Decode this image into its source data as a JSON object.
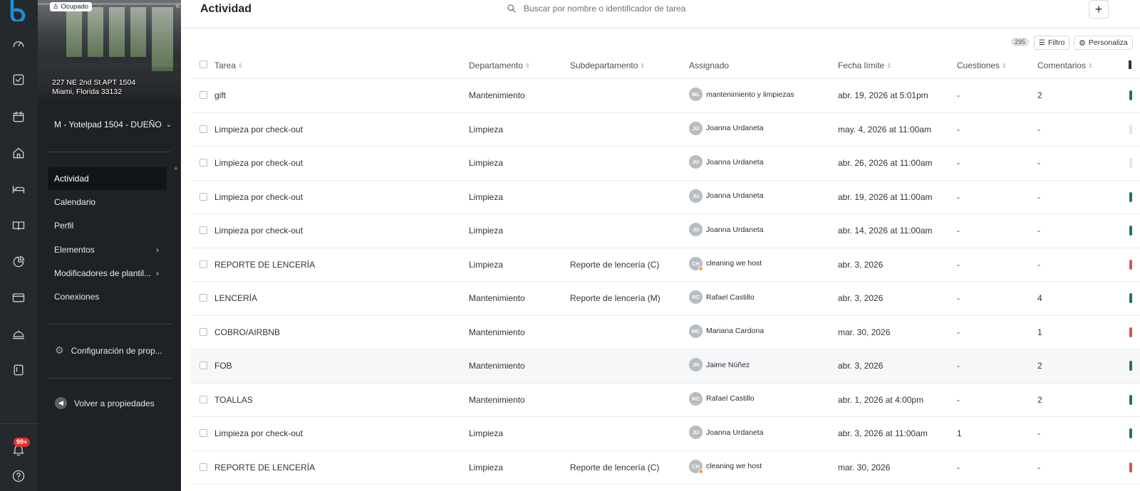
{
  "sidebar": {
    "status_badge": "Ocupado",
    "address_line1": "227 NE 2nd St APT 1504",
    "address_line2": "Miami, Florida 33132",
    "owner_label": "M - Yotelpad 1504 - DUEÑO",
    "nav": [
      {
        "label": "Actividad",
        "active": true
      },
      {
        "label": "Calendario"
      },
      {
        "label": "Perfil"
      },
      {
        "label": "Elementos",
        "submenu": true
      },
      {
        "label": "Modificadores de plantil...",
        "submenu": true
      },
      {
        "label": "Conexiones"
      }
    ],
    "config_label": "Configuración de prop...",
    "back_label": "Volver a propiedades"
  },
  "rail": {
    "icons": [
      "dashboard-icon",
      "inbox-icon",
      "calendar-icon",
      "home-icon",
      "bed-icon",
      "book-icon",
      "chart-icon",
      "card-icon",
      "service-icon",
      "document-icon"
    ],
    "notification_badge": "99+"
  },
  "header": {
    "title": "Actividad",
    "search_placeholder": "Buscar por nombre o identificador de tarea"
  },
  "toolbar": {
    "count": "295",
    "filter_label": "Filtro",
    "customize_label": "Personaliza"
  },
  "table": {
    "columns": [
      "Tarea",
      "Departamento",
      "Subdepartamento",
      "Assignado",
      "Fecha límite",
      "Cuestiones",
      "Comentarios"
    ],
    "rows": [
      {
        "task": "gift",
        "dept": "Mantenimiento",
        "subdept": "",
        "initials": "ML",
        "assignee": "mantenimiento y limpiezas",
        "due": "abr. 19, 2026 at 5:01pm",
        "issues": "-",
        "comments": "2",
        "edge": "#1e7a46"
      },
      {
        "task": "Limpieza por check-out",
        "dept": "Limpieza",
        "subdept": "",
        "initials": "JU",
        "assignee": "Joanna Urdaneta",
        "due": "may. 4, 2026 at 11:00am",
        "issues": "-",
        "comments": "-",
        "edge": "#e3e6e9"
      },
      {
        "task": "Limpieza por check-out",
        "dept": "Limpieza",
        "subdept": "",
        "initials": "JU",
        "assignee": "Joanna Urdaneta",
        "due": "abr. 26, 2026 at 11:00am",
        "issues": "-",
        "comments": "-",
        "edge": "#e3e6e9"
      },
      {
        "task": "Limpieza por check-out",
        "dept": "Limpieza",
        "subdept": "",
        "initials": "JU",
        "assignee": "Joanna Urdaneta",
        "due": "abr. 19, 2026 at 11:00am",
        "issues": "-",
        "comments": "-",
        "edge": "#1e7a46"
      },
      {
        "task": "Limpieza por check-out",
        "dept": "Limpieza",
        "subdept": "",
        "initials": "JU",
        "assignee": "Joanna Urdaneta",
        "due": "abr. 14, 2026 at 11:00am",
        "issues": "-",
        "comments": "-",
        "edge": "#1e7a46"
      },
      {
        "task": "REPORTE DE LENCERÍA",
        "dept": "Limpieza",
        "subdept": "Reporte de lencería (C)",
        "initials": "CH",
        "assignee": "cleaning we host",
        "due": "abr. 3, 2026",
        "issues": "-",
        "comments": "-",
        "edge": "#d9534f",
        "star": true
      },
      {
        "task": "LENCERÍA",
        "dept": "Mantenimiento",
        "subdept": "Reporte de lencería (M)",
        "initials": "RC",
        "assignee": "Rafael Castillo",
        "due": "abr. 3, 2026",
        "issues": "-",
        "comments": "4",
        "edge": "#1e7a46"
      },
      {
        "task": "COBRO/AIRBNB",
        "dept": "Mantenimiento",
        "subdept": "",
        "initials": "MC",
        "assignee": "Mariana Cardona",
        "due": "mar. 30, 2026",
        "issues": "-",
        "comments": "1",
        "edge": "#d9534f"
      },
      {
        "task": "FOB",
        "dept": "Mantenimiento",
        "subdept": "",
        "initials": "JN",
        "assignee": "Jaime Núñez",
        "due": "abr. 3, 2026",
        "issues": "-",
        "comments": "2",
        "edge": "#1e7a46",
        "highlight": true
      },
      {
        "task": "TOALLAS",
        "dept": "Mantenimiento",
        "subdept": "",
        "initials": "RC",
        "assignee": "Rafael Castillo",
        "due": "abr. 1, 2026 at 4:00pm",
        "issues": "-",
        "comments": "2",
        "edge": "#1e7a46"
      },
      {
        "task": "Limpieza por check-out",
        "dept": "Limpieza",
        "subdept": "",
        "initials": "JU",
        "assignee": "Joanna Urdaneta",
        "due": "abr. 3, 2026 at 11:00am",
        "issues": "1",
        "comments": "-",
        "edge": "#1e7a46"
      },
      {
        "task": "REPORTE DE LENCERÍA",
        "dept": "Limpieza",
        "subdept": "Reporte de lencería (C)",
        "initials": "CH",
        "assignee": "cleaning we host",
        "due": "mar. 30, 2026",
        "issues": "-",
        "comments": "-",
        "edge": "#d9534f",
        "star": true
      }
    ]
  }
}
